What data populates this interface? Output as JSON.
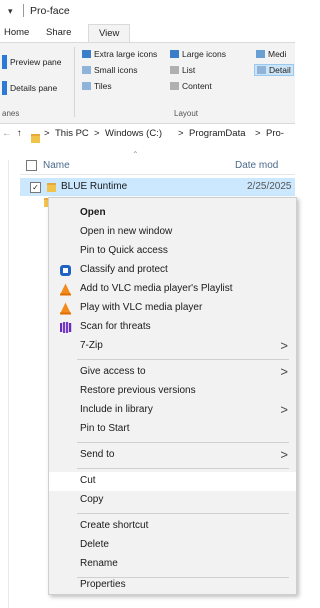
{
  "window": {
    "title": "Pro-face",
    "title_dropdown": "▾"
  },
  "ribbon_tabs": [
    "Home",
    "Share",
    "View"
  ],
  "ribbon": {
    "panes": {
      "preview": "Preview pane",
      "details": "Details pane",
      "group_label": "anes"
    },
    "layout": {
      "extra_large": "Extra large icons",
      "large": "Large icons",
      "medium": "Medi",
      "small": "Small icons",
      "list": "List",
      "details": "Detail",
      "tiles": "Tiles",
      "content": "Content",
      "group_label": "Layout"
    }
  },
  "address": {
    "back": "←",
    "up": "↑",
    "sep": ">",
    "crumbs": [
      "This PC",
      "Windows (C:)",
      "ProgramData",
      "Pro-"
    ]
  },
  "columns": {
    "name": "Name",
    "date": "Date mod"
  },
  "selected_item": {
    "name": "BLUE Runtime",
    "date": "2/25/2025"
  },
  "context_menu": {
    "items": [
      {
        "label": "Open",
        "bold": true
      },
      {
        "label": "Open in new window"
      },
      {
        "label": "Pin to Quick access"
      },
      {
        "label": "Classify and protect",
        "icon": "classify-icon"
      },
      {
        "label": "Add to VLC media player's Playlist",
        "icon": "vlc-icon"
      },
      {
        "label": "Play with VLC media player",
        "icon": "vlc-icon"
      },
      {
        "label": "Scan for threats",
        "icon": "defender-icon"
      },
      {
        "label": "7-Zip",
        "submenu": true
      },
      {
        "label": "Give access to",
        "submenu": true
      },
      {
        "label": "Restore previous versions"
      },
      {
        "label": "Include in library",
        "submenu": true
      },
      {
        "label": "Pin to Start"
      },
      {
        "label": "Send to",
        "submenu": true
      },
      {
        "label": "Cut"
      },
      {
        "label": "Copy"
      },
      {
        "label": "Create shortcut"
      },
      {
        "label": "Delete"
      },
      {
        "label": "Rename"
      },
      {
        "label": "Properties"
      }
    ],
    "arrow": ">"
  },
  "colors": {
    "accent": "#0078d7",
    "selection": "#cce8ff",
    "folder": "#f2c34b"
  }
}
